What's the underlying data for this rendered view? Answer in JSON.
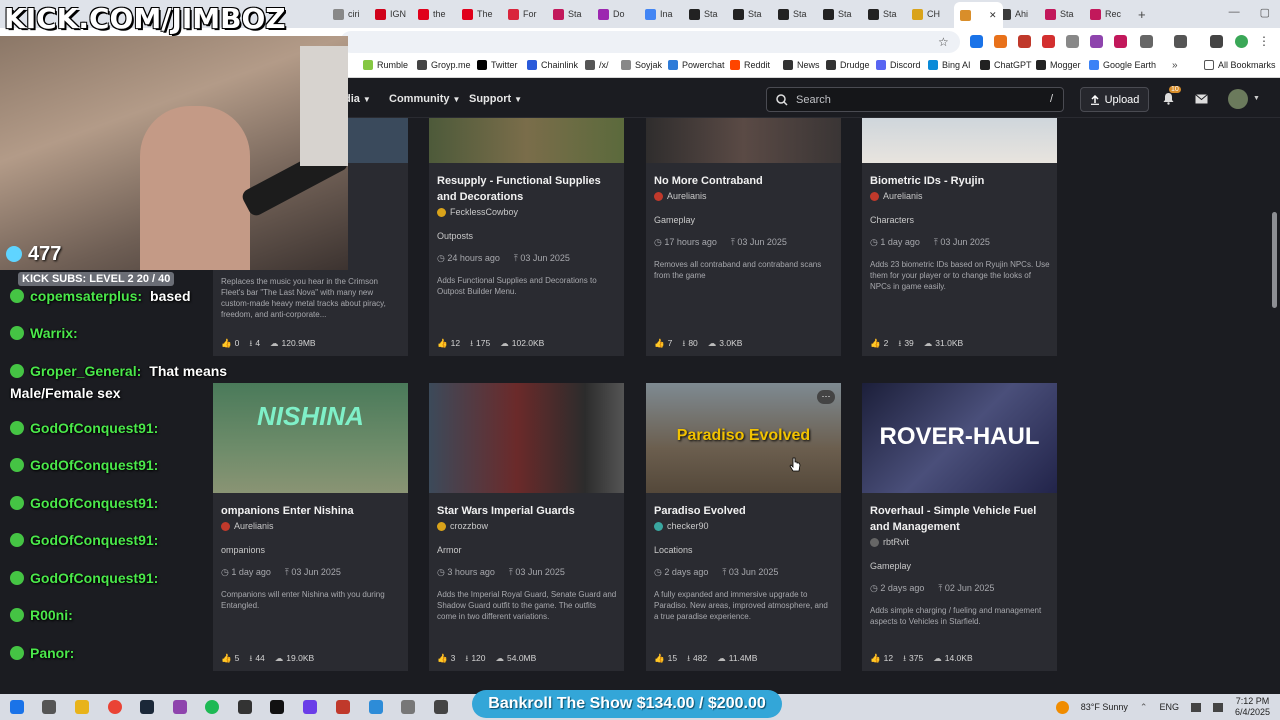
{
  "browser": {
    "tabs": [
      {
        "label": "ciri",
        "color": "#888888"
      },
      {
        "label": "IGN",
        "color": "#d0021b"
      },
      {
        "label": "the",
        "color": "#e0001b"
      },
      {
        "label": "The",
        "color": "#e0001b"
      },
      {
        "label": "For",
        "color": "#d9253c"
      },
      {
        "label": "Sta",
        "color": "#c2185b"
      },
      {
        "label": "Do",
        "color": "#9c27b0"
      },
      {
        "label": "Ina",
        "color": "#4285f4"
      },
      {
        "label": "Sta",
        "color": "#222222"
      },
      {
        "label": "Sta",
        "color": "#222222"
      },
      {
        "label": "Sta",
        "color": "#222222"
      },
      {
        "label": "Sta",
        "color": "#222222"
      },
      {
        "label": "Sta",
        "color": "#222222"
      },
      {
        "label": "CH",
        "color": "#d9a31a"
      },
      {
        "label": "Ahi",
        "color": "#3b3b3b"
      },
      {
        "label": "Sta",
        "color": "#c2185b"
      },
      {
        "label": "Rec",
        "color": "#c2185b"
      }
    ],
    "bookmarks": [
      {
        "label": "Rumble",
        "color": "#85c742"
      },
      {
        "label": "Groyp.me",
        "color": "#444444"
      },
      {
        "label": "Twitter",
        "color": "#000000"
      },
      {
        "label": "Chainlink",
        "color": "#2a5ada"
      },
      {
        "label": "/x/",
        "color": "#555555"
      },
      {
        "label": "Soyjak",
        "color": "#888888"
      },
      {
        "label": "Powerchat",
        "color": "#2d7bd8"
      },
      {
        "label": "Reddit",
        "color": "#ff4500"
      },
      {
        "label": "News",
        "color": "#333333"
      },
      {
        "label": "Drudge",
        "color": "#333333"
      },
      {
        "label": "Discord",
        "color": "#5865f2"
      },
      {
        "label": "Bing AI",
        "color": "#0a8ad8"
      },
      {
        "label": "ChatGPT",
        "color": "#222222"
      },
      {
        "label": "Mogger",
        "color": "#222222"
      },
      {
        "label": "Google Earth",
        "color": "#3b82f6"
      }
    ],
    "all_bookmarks": "All Bookmarks"
  },
  "site": {
    "nav": [
      {
        "label": "dia"
      },
      {
        "label": "Community"
      },
      {
        "label": "Support"
      }
    ],
    "search_placeholder": "Search",
    "search_shortcut": "/",
    "upload_label": "Upload",
    "notification_count": "10"
  },
  "cards_row1": [
    {
      "title": "Fleet",
      "author": "",
      "category": "",
      "time": "",
      "date": "",
      "desc": "Replaces the music you hear in the Crimson Fleet's bar \"The Last Nova\" with many new custom-made heavy metal tracks about piracy, freedom, and anti-corporate...",
      "endorse": "0",
      "downloads": "4",
      "size": "120.9MB"
    },
    {
      "title": "Resupply - Functional Supplies and Decorations",
      "author": "FecklessCowboy",
      "category": "Outposts",
      "time": "24 hours ago",
      "date": "03 Jun 2025",
      "desc": "Adds Functional Supplies and Decorations to Outpost Builder Menu.",
      "endorse": "12",
      "downloads": "175",
      "size": "102.0KB"
    },
    {
      "title": "No More Contraband",
      "author": "Aurelianis",
      "category": "Gameplay",
      "time": "17 hours ago",
      "date": "03 Jun 2025",
      "desc": "Removes all contraband and contraband scans from the game",
      "endorse": "7",
      "downloads": "80",
      "size": "3.0KB"
    },
    {
      "title": "Biometric IDs - Ryujin",
      "author": "Aurelianis",
      "category": "Characters",
      "time": "1 day ago",
      "date": "03 Jun 2025",
      "desc": "Adds 23 biometric IDs based on Ryujin NPCs. Use them for your player or to change the looks of NPCs in game easily.",
      "endorse": "2",
      "downloads": "39",
      "size": "31.0KB"
    }
  ],
  "cards_row2": [
    {
      "title": "ompanions Enter Nishina",
      "author": "Aurelianis",
      "category": "ompanions",
      "time": "1 day ago",
      "date": "03 Jun 2025",
      "desc": "Companions will enter Nishina with you during Entangled.",
      "endorse": "5",
      "downloads": "44",
      "size": "19.0KB",
      "thumb_text": "NISHINA"
    },
    {
      "title": "Star Wars Imperial Guards",
      "author": "crozzbow",
      "category": "Armor",
      "time": "3 hours ago",
      "date": "03 Jun 2025",
      "desc": "Adds the Imperial Royal Guard, Senate Guard and Shadow Guard outfit to the game. The outfits come in two different variations.",
      "endorse": "3",
      "downloads": "120",
      "size": "54.0MB",
      "thumb_text": ""
    },
    {
      "title": "Paradiso Evolved",
      "author": "checker90",
      "category": "Locations",
      "time": "2 days ago",
      "date": "03 Jun 2025",
      "desc": "A fully expanded and immersive upgrade to Paradiso. New areas, improved atmosphere, and a true paradise experience.",
      "endorse": "15",
      "downloads": "482",
      "size": "11.4MB",
      "thumb_text": "Paradiso Evolved"
    },
    {
      "title": "Roverhaul - Simple Vehicle Fuel and Management",
      "author": "rbtRvit",
      "category": "Gameplay",
      "time": "2 days ago",
      "date": "02 Jun 2025",
      "desc": "Adds simple charging / fueling and management aspects to Vehicles in Starfield.",
      "endorse": "12",
      "downloads": "375",
      "size": "14.0KB",
      "thumb_text": "ROVER-HAUL"
    }
  ],
  "stream": {
    "logo": "KICK.COM/JIMBOZ",
    "viewers": "477",
    "subs": "KICK SUBS: LEVEL 2 20 / 40",
    "chat": [
      {
        "user": "copemsaterplus:",
        "msg": "based"
      },
      {
        "user": "Warrix:",
        "msg": ""
      },
      {
        "user": "Groper_General:",
        "msg": "That means"
      },
      {
        "user": "",
        "msg": "Male/Female sex"
      },
      {
        "user": "GodOfConquest91:",
        "msg": ""
      },
      {
        "user": "GodOfConquest91:",
        "msg": ""
      },
      {
        "user": "GodOfConquest91:",
        "msg": ""
      },
      {
        "user": "GodOfConquest91:",
        "msg": ""
      },
      {
        "user": "GodOfConquest91:",
        "msg": ""
      },
      {
        "user": "R00ni:",
        "msg": ""
      },
      {
        "user": "Panor:",
        "msg": ""
      }
    ],
    "bankroll": "Bankroll The Show $134.00 / $200.00"
  },
  "taskbar": {
    "weather": "83°F  Sunny",
    "lang": "ENG",
    "time": "7:12 PM",
    "date": "6/4/2025"
  }
}
